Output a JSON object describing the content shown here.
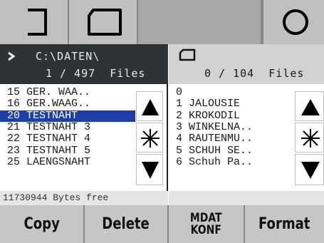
{
  "toolbar": {
    "buttons": [
      {
        "icon": "bracket-icon"
      },
      {
        "icon": "rounded-rect-icon"
      },
      {
        "icon": "blank"
      },
      {
        "icon": "circle-icon"
      }
    ]
  },
  "left_header": {
    "path": "C:\\DATEN\\",
    "count": "1 / 497  Files"
  },
  "right_header": {
    "path": "",
    "count": "0 / 104  Files"
  },
  "left_list": [
    {
      "text": "15 GER. WAA.."
    },
    {
      "text": "16 GER.WAAG.."
    },
    {
      "text": "20 TESTNAHT"
    },
    {
      "text": "21 TESTNAHT 3"
    },
    {
      "text": "22 TESTNAHT 4"
    },
    {
      "text": "23 TESTNAHT 5"
    },
    {
      "text": "25 LAENGSNAHT"
    }
  ],
  "right_list": [
    {
      "text": "0"
    },
    {
      "text": "1 JALOUSIE"
    },
    {
      "text": "2 KROKODIL"
    },
    {
      "text": "3 WINKELNA.."
    },
    {
      "text": "4 RAUTENMU.."
    },
    {
      "text": "5 SCHUH SE.."
    },
    {
      "text": "6 Schuh Pa.."
    }
  ],
  "status": {
    "free": "11730944 Bytes free"
  },
  "function_buttons": {
    "copy": "Copy",
    "delete": "Delete",
    "mdat": "MDAT\nKONF",
    "format": "Format"
  },
  "colors": {
    "selection": "#1f3fa8",
    "header_dark": "#2e3336",
    "button_face": "#c6c6c6"
  }
}
